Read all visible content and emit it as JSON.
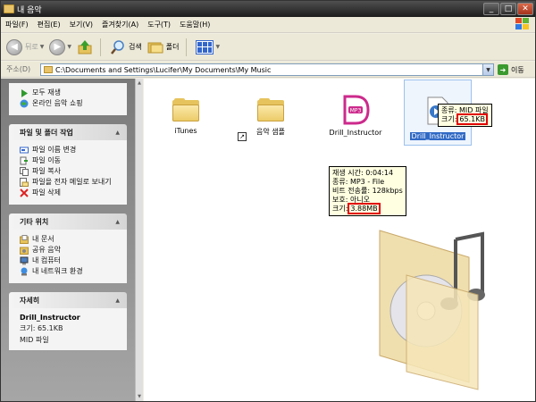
{
  "window": {
    "title": "내 음악"
  },
  "window_buttons": {
    "minimize": "_",
    "maximize": "□",
    "close": "✕"
  },
  "menu": [
    "파일(F)",
    "편집(E)",
    "보기(V)",
    "즐겨찾기(A)",
    "도구(T)",
    "도움말(H)"
  ],
  "toolbar": {
    "back": "뒤로",
    "search": "검색",
    "folders": "폴더"
  },
  "address": {
    "label": "주소(D)",
    "path": "C:\\Documents and Settings\\Lucifer\\My Documents\\My Music",
    "go": "이동"
  },
  "sidebar": {
    "music_tasks": [
      {
        "label": "모두 재생",
        "icon": "play-icon"
      },
      {
        "label": "온라인 음악 쇼핑",
        "icon": "globe-icon"
      }
    ],
    "file_tasks": {
      "title": "파일 및 폴더 작업",
      "items": [
        {
          "label": "파일 이름 변경",
          "icon": "rename-icon"
        },
        {
          "label": "파일 이동",
          "icon": "move-icon"
        },
        {
          "label": "파일 복사",
          "icon": "copy-icon"
        },
        {
          "label": "파일을 전자 메일로 보내기",
          "icon": "email-icon"
        },
        {
          "label": "파일 삭제",
          "icon": "delete-icon"
        }
      ]
    },
    "other_places": {
      "title": "기타 위치",
      "items": [
        {
          "label": "내 문서",
          "icon": "my-documents-icon"
        },
        {
          "label": "공유 음악",
          "icon": "shared-music-icon"
        },
        {
          "label": "내 컴퓨터",
          "icon": "my-computer-icon"
        },
        {
          "label": "내 네트워크 환경",
          "icon": "network-icon"
        }
      ]
    },
    "details": {
      "title": "자세히",
      "name": "Drill_Instructor",
      "size": "크기: 65.1KB",
      "type": "MID 파일"
    }
  },
  "files": [
    {
      "name": "iTunes",
      "type": "folder"
    },
    {
      "name": "음악 샘플",
      "type": "folder-shortcut"
    },
    {
      "name": "Drill_Instructor",
      "type": "mp3"
    },
    {
      "name": "Drill_Instructor",
      "type": "mid",
      "selected": true
    }
  ],
  "tooltip_mid": {
    "type_line": "종류: MID 파일",
    "size_label": "크기:",
    "size_value": "65.1KB"
  },
  "tooltip_mp3": {
    "duration": "재생 시간: 0:04:14",
    "type": "종류: MP3 - File",
    "bitrate": "비트 전송률: 128kbps",
    "protected": "보호: 아니오",
    "size_label": "크기:",
    "size_value": "3.88MB"
  },
  "colors": {
    "selection": "#316ac5",
    "highlight": "#e00000",
    "tooltip_bg": "#ffffe1"
  }
}
